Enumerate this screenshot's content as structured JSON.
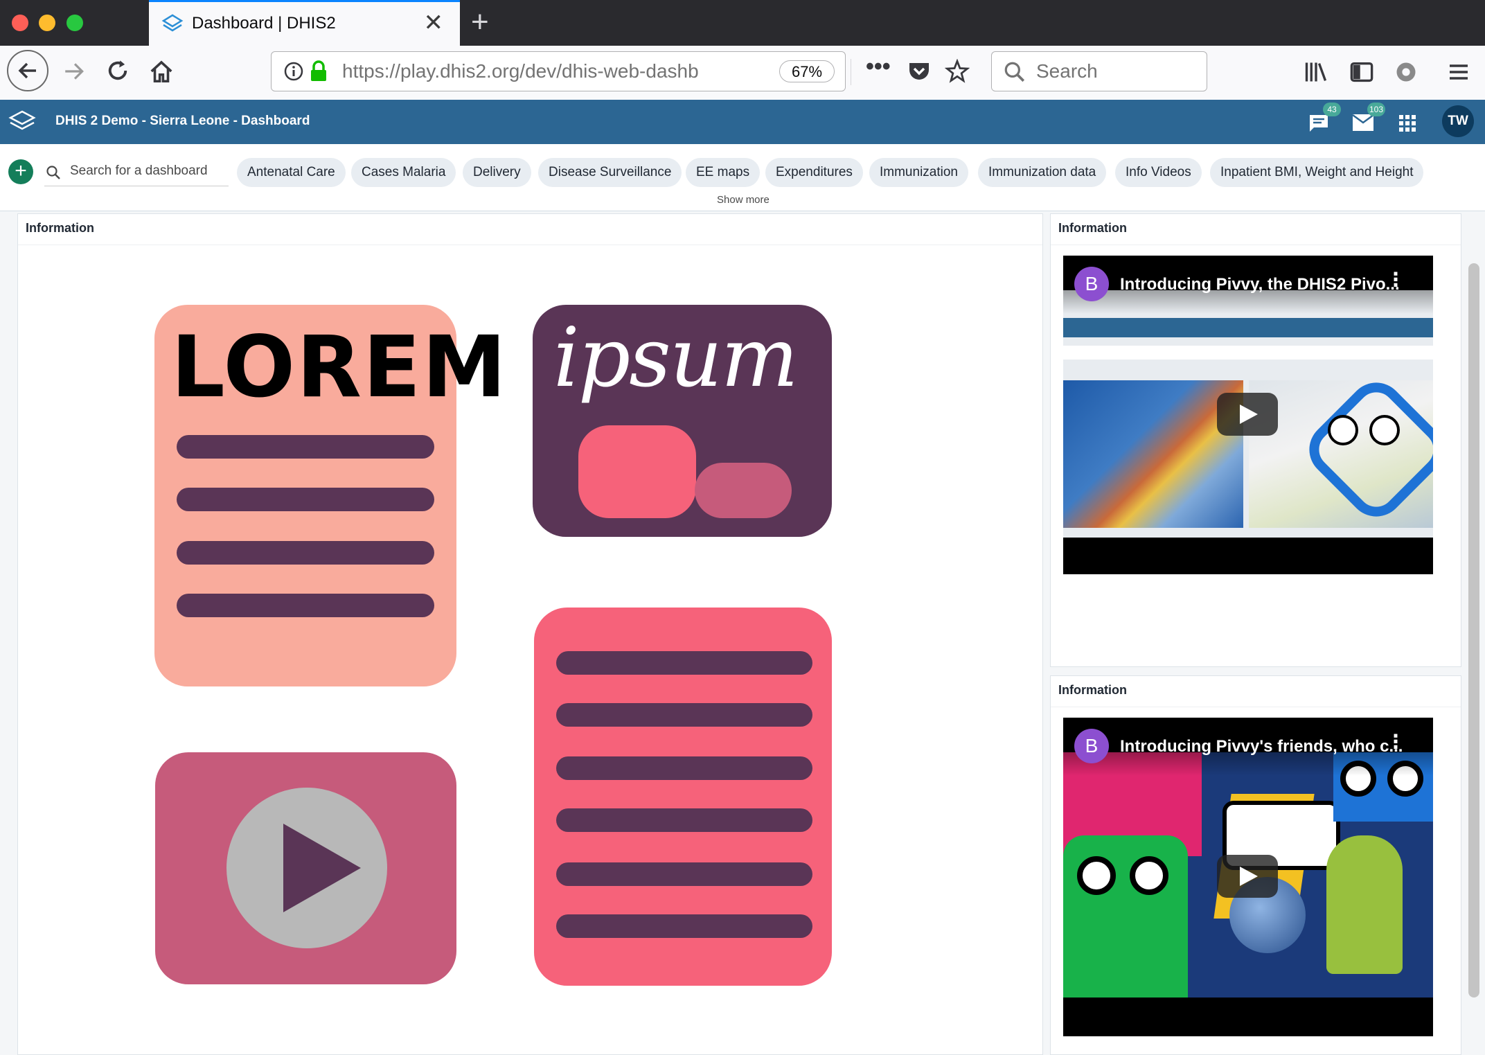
{
  "browser": {
    "tab_title": "Dashboard | DHIS2",
    "url": "https://play.dhis2.org/dev/dhis-web-dashb",
    "zoom": "67%",
    "search_placeholder": "Search"
  },
  "header": {
    "title": "DHIS 2 Demo - Sierra Leone - Dashboard",
    "messages_count": "43",
    "interpretations_count": "103",
    "avatar_initials": "TW"
  },
  "dashboards": {
    "search_placeholder": "Search for a dashboard",
    "chips": [
      "Antenatal Care",
      "Cases Malaria",
      "Delivery",
      "Disease Surveillance",
      "EE maps",
      "Expenditures",
      "Immunization",
      "Immunization data",
      "Info Videos",
      "Inpatient BMI, Weight and Height"
    ],
    "show_more": "Show more"
  },
  "items": [
    {
      "title": "Information",
      "illustration_text": {
        "lorem": "LOREM",
        "ipsum": "ipsum"
      }
    },
    {
      "title": "Information",
      "video": {
        "channel_initial": "B",
        "title": "Introducing Pivvy, the DHIS2 Pivo..."
      }
    },
    {
      "title": "Information",
      "video": {
        "channel_initial": "B",
        "title": "Introducing Pivvy's friends, who c..."
      }
    }
  ],
  "colors": {
    "header_blue": "#2c6693",
    "peach": "#f9ab9c",
    "plum": "#5a3556",
    "coral": "#f6627a",
    "rose": "#c65b7b"
  }
}
